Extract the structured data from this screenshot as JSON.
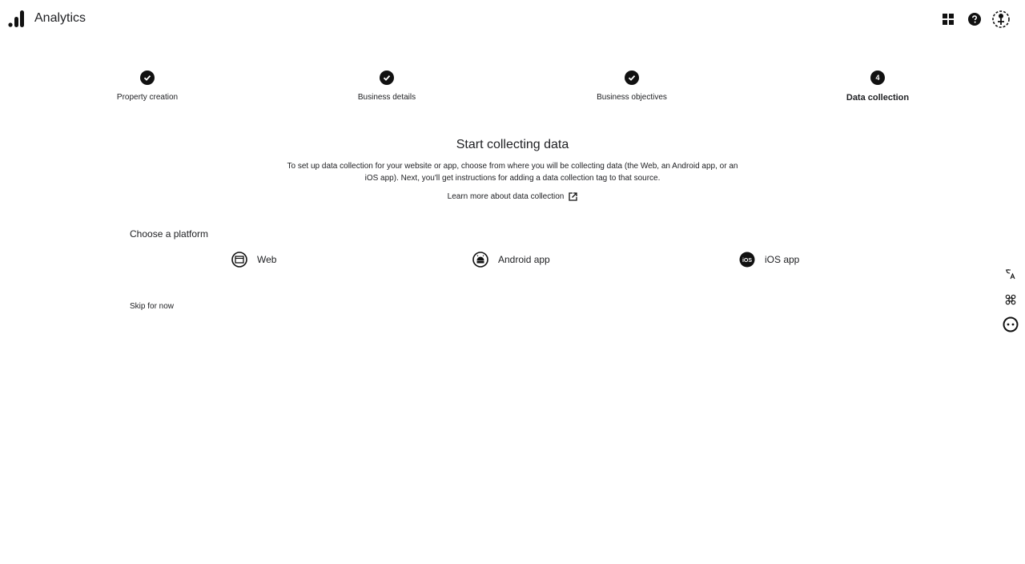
{
  "header": {
    "app_title": "Analytics",
    "icons": [
      "analytics-logo",
      "apps-grid-icon",
      "help-icon",
      "account-avatar-icon"
    ]
  },
  "stepper": {
    "steps": [
      {
        "label": "Property creation",
        "status": "completed"
      },
      {
        "label": "Business details",
        "status": "completed"
      },
      {
        "label": "Business objectives",
        "status": "completed"
      },
      {
        "label": "Data collection",
        "status": "current",
        "number": "4"
      }
    ]
  },
  "main": {
    "title": "Start collecting data",
    "intro": "To set up data collection for your website or app, choose from where you will be collecting data (the Web, an Android app, or an iOS app). Next, you'll get instructions for adding a data collection tag to that source.",
    "learn_more": "Learn more about data collection",
    "choose_label": "Choose a platform",
    "platforms": [
      {
        "label": "Web",
        "icon": "globe-icon"
      },
      {
        "label": "Android app",
        "icon": "android-icon"
      },
      {
        "label": "iOS app",
        "icon": "ios-icon"
      }
    ],
    "skip": "Skip for now"
  },
  "side_rail": {
    "icons": [
      "translate-icon",
      "command-icon",
      "face-icon"
    ]
  },
  "colors": {
    "text": "#202124",
    "dark": "#111111",
    "background": "#ffffff"
  }
}
